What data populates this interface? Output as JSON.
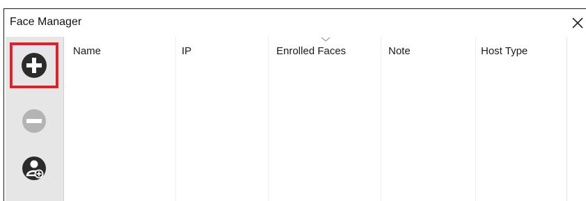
{
  "window": {
    "title": "Face Manager"
  },
  "toolbar": {
    "buttons": [
      {
        "name": "add",
        "icon": "plus-circle-icon",
        "highlighted": true,
        "highlight_color": "#e0202a"
      },
      {
        "name": "remove",
        "icon": "minus-circle-icon",
        "enabled": false
      },
      {
        "name": "add-user",
        "icon": "user-add-icon"
      }
    ]
  },
  "table": {
    "columns": [
      "Name",
      "IP",
      "Enrolled Faces",
      "Note",
      "Host Type"
    ],
    "sorted_column": "Enrolled Faces",
    "rows": []
  },
  "colors": {
    "toolbar_bg": "#e6e6e6",
    "icon_dark": "#2b2b2b",
    "icon_disabled": "#b4b4b4",
    "highlight": "#e0202a"
  }
}
